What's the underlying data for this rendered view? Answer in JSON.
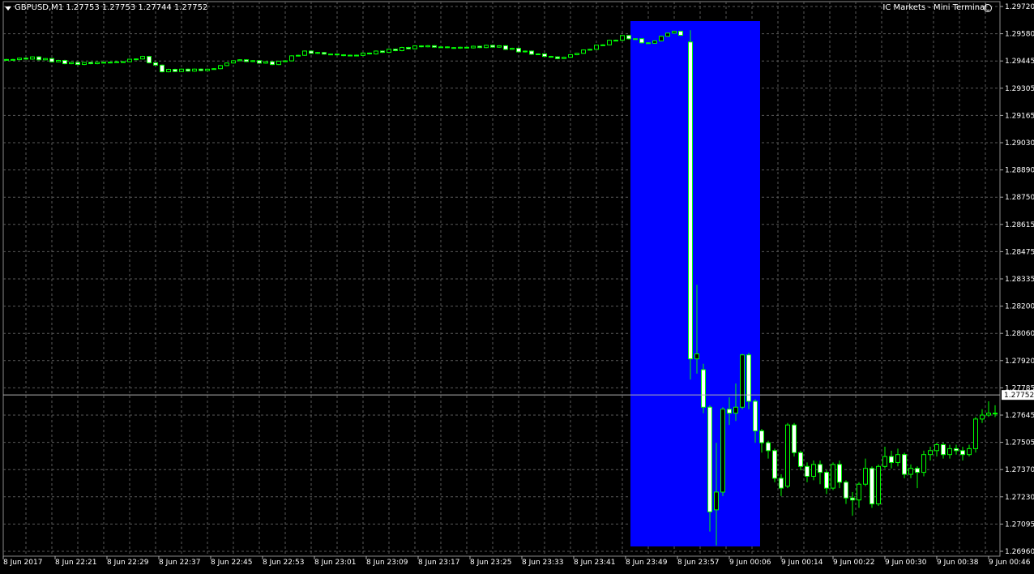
{
  "header": {
    "symbol_line": "GBPUSD,M1  1.27753 1.27753 1.27744 1.27752",
    "terminal_label": "IC Markets - Mini Terminal"
  },
  "colors": {
    "background": "#000000",
    "grid": "#5a5a5a",
    "bull_candle": "#000000",
    "bear_candle": "#ffffff",
    "wick_up": "#00ff00",
    "highlight_zone": "#0000ff",
    "text": "#ffffff"
  },
  "chart_data": {
    "type": "candlestick",
    "symbol": "GBPUSD",
    "timeframe": "M1",
    "current_price": 1.27752,
    "current_price_label": "1.27752",
    "ohlc_header": {
      "open": 1.27753,
      "high": 1.27753,
      "low": 1.27744,
      "close": 1.27752
    },
    "y_range": [
      1.2696,
      1.2972
    ],
    "y_ticks": [
      "1.29720",
      "1.29580",
      "1.29445",
      "1.29305",
      "1.29165",
      "1.29030",
      "1.28890",
      "1.28750",
      "1.28615",
      "1.28475",
      "1.28335",
      "1.28200",
      "1.28060",
      "1.27920",
      "1.27785",
      "1.27645",
      "1.27505",
      "1.27370",
      "1.27230",
      "1.27095",
      "1.26960"
    ],
    "x_ticks": [
      "8 Jun 2017",
      "8 Jun 22:21",
      "8 Jun 22:29",
      "8 Jun 22:37",
      "8 Jun 22:45",
      "8 Jun 22:53",
      "8 Jun 23:01",
      "8 Jun 23:09",
      "8 Jun 23:17",
      "8 Jun 23:25",
      "8 Jun 23:33",
      "8 Jun 23:41",
      "8 Jun 23:49",
      "8 Jun 23:57",
      "9 Jun 00:06",
      "9 Jun 00:14",
      "9 Jun 00:22",
      "9 Jun 00:30",
      "9 Jun 00:38",
      "9 Jun 00:46"
    ],
    "grid": true,
    "highlight_zone": {
      "from": "8 Jun 23:47",
      "to": "9 Jun 00:06"
    }
  }
}
